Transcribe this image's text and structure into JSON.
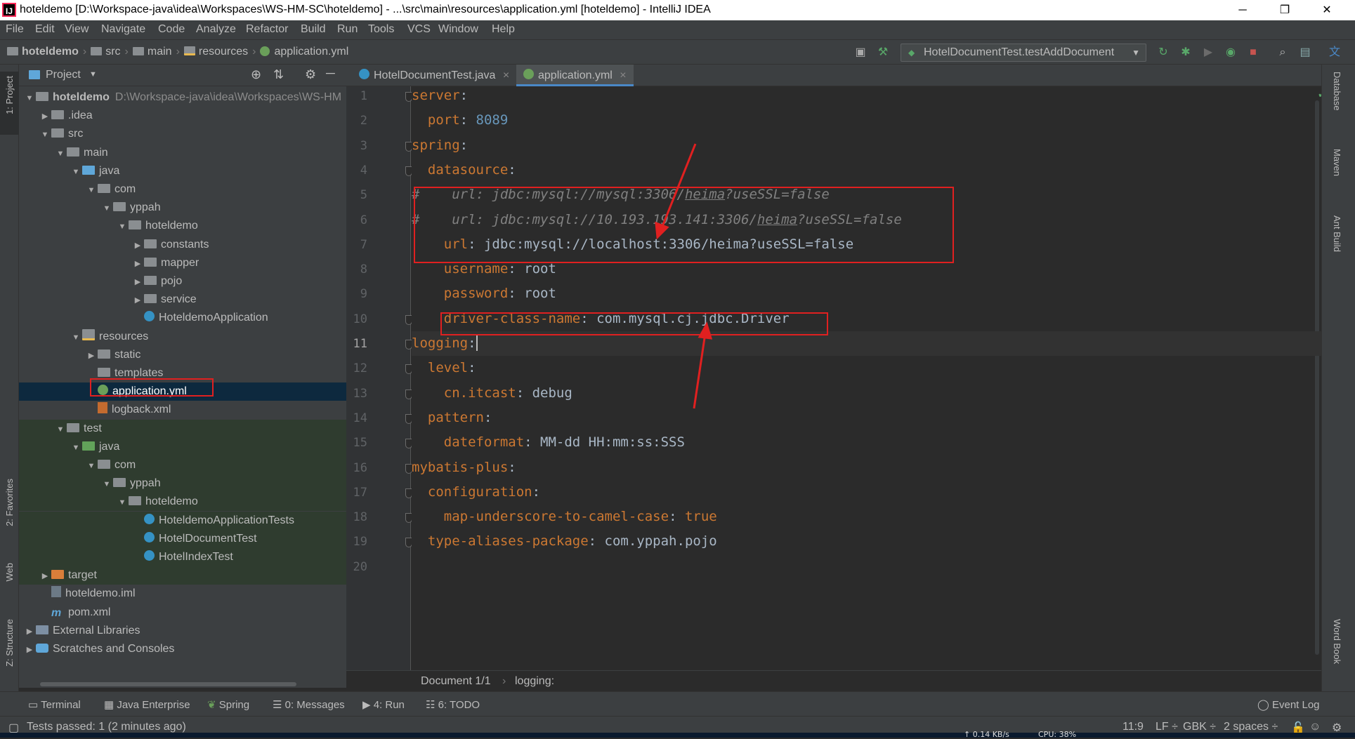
{
  "window": {
    "title": "hoteldemo [D:\\Workspace-java\\idea\\Workspaces\\WS-HM-SC\\hoteldemo] - ...\\src\\main\\resources\\application.yml [hoteldemo] - IntelliJ IDEA",
    "minimize": "─",
    "restore": "❐",
    "close": "✕"
  },
  "menu": [
    "File",
    "Edit",
    "View",
    "Navigate",
    "Code",
    "Analyze",
    "Refactor",
    "Build",
    "Run",
    "Tools",
    "VCS",
    "Window",
    "Help"
  ],
  "navbar": {
    "crumbs": [
      "hoteldemo",
      "src",
      "main",
      "resources",
      "application.yml"
    ],
    "run_config": "HotelDocumentTest.testAddDocument"
  },
  "left_stripe": {
    "project": "1: Project",
    "favorites": "2: Favorites",
    "web": "Web",
    "structure": "Z: Structure"
  },
  "right_stripe": {
    "database": "Database",
    "maven": "Maven",
    "ant": "Ant Build",
    "wordbook": "Word Book"
  },
  "project_panel": {
    "title": "Project",
    "tree": [
      {
        "label": "hoteldemo",
        "extra": "D:\\Workspace-java\\idea\\Workspaces\\WS-HM",
        "depth": 0,
        "arrow": "▼",
        "icon": "folder",
        "bold": true
      },
      {
        "label": ".idea",
        "depth": 1,
        "arrow": "▶",
        "icon": "folder"
      },
      {
        "label": "src",
        "depth": 1,
        "arrow": "▼",
        "icon": "folder"
      },
      {
        "label": "main",
        "depth": 2,
        "arrow": "▼",
        "icon": "folder"
      },
      {
        "label": "java",
        "depth": 3,
        "arrow": "▼",
        "icon": "src"
      },
      {
        "label": "com",
        "depth": 4,
        "arrow": "▼",
        "icon": "folder"
      },
      {
        "label": "yppah",
        "depth": 5,
        "arrow": "▼",
        "icon": "folder"
      },
      {
        "label": "hoteldemo",
        "depth": 6,
        "arrow": "▼",
        "icon": "folder"
      },
      {
        "label": "constants",
        "depth": 7,
        "arrow": "▶",
        "icon": "folder"
      },
      {
        "label": "mapper",
        "depth": 7,
        "arrow": "▶",
        "icon": "folder"
      },
      {
        "label": "pojo",
        "depth": 7,
        "arrow": "▶",
        "icon": "folder"
      },
      {
        "label": "service",
        "depth": 7,
        "arrow": "▶",
        "icon": "folder"
      },
      {
        "label": "HoteldemoApplication",
        "depth": 7,
        "arrow": "",
        "icon": "cls"
      },
      {
        "label": "resources",
        "depth": 3,
        "arrow": "▼",
        "icon": "res"
      },
      {
        "label": "static",
        "depth": 4,
        "arrow": "▶",
        "icon": "folder"
      },
      {
        "label": "templates",
        "depth": 4,
        "arrow": "",
        "icon": "folder"
      },
      {
        "label": "application.yml",
        "depth": 4,
        "arrow": "",
        "icon": "yml",
        "selected": true
      },
      {
        "label": "logback.xml",
        "depth": 4,
        "arrow": "",
        "icon": "xml"
      },
      {
        "label": "test",
        "depth": 2,
        "arrow": "▼",
        "icon": "folder",
        "test": true
      },
      {
        "label": "java",
        "depth": 3,
        "arrow": "▼",
        "icon": "testsrc",
        "test": true
      },
      {
        "label": "com",
        "depth": 4,
        "arrow": "▼",
        "icon": "folder",
        "test": true
      },
      {
        "label": "yppah",
        "depth": 5,
        "arrow": "▼",
        "icon": "folder",
        "test": true
      },
      {
        "label": "hoteldemo",
        "depth": 6,
        "arrow": "▼",
        "icon": "folder",
        "test": true
      },
      {
        "label": "HoteldemoApplicationTests",
        "depth": 7,
        "arrow": "",
        "icon": "cls",
        "test": true
      },
      {
        "label": "HotelDocumentTest",
        "depth": 7,
        "arrow": "",
        "icon": "cls",
        "test": true
      },
      {
        "label": "HotelIndexTest",
        "depth": 7,
        "arrow": "",
        "icon": "cls",
        "test": true
      },
      {
        "label": "target",
        "depth": 1,
        "arrow": "▶",
        "icon": "target",
        "test": true
      },
      {
        "label": "hoteldemo.iml",
        "depth": 1,
        "arrow": "",
        "icon": "iml"
      },
      {
        "label": "pom.xml",
        "depth": 1,
        "arrow": "",
        "icon": "mvn"
      },
      {
        "label": "External Libraries",
        "depth": 0,
        "arrow": "▶",
        "icon": "lib"
      },
      {
        "label": "Scratches and Consoles",
        "depth": 0,
        "arrow": "▶",
        "icon": "scratch"
      }
    ]
  },
  "editor": {
    "tabs": [
      {
        "label": "HotelDocumentTest.java",
        "active": false
      },
      {
        "label": "application.yml",
        "active": true
      }
    ],
    "current_line": 11,
    "lines": [
      [
        [
          "k",
          "server"
        ],
        [
          "p",
          ":"
        ]
      ],
      [
        [
          "p",
          "  "
        ],
        [
          "k",
          "port"
        ],
        [
          "p",
          ": "
        ],
        [
          "n",
          "8089"
        ]
      ],
      [
        [
          "k",
          "spring"
        ],
        [
          "p",
          ":"
        ]
      ],
      [
        [
          "p",
          "  "
        ],
        [
          "k",
          "datasource"
        ],
        [
          "p",
          ":"
        ]
      ],
      [
        [
          "c",
          "#    url: jdbc:mysql://mysql:3306/"
        ],
        [
          "cu",
          "heima"
        ],
        [
          "c",
          "?useSSL=false"
        ]
      ],
      [
        [
          "c",
          "#    url: jdbc:mysql://10.193.193.141:3306/"
        ],
        [
          "cu",
          "heima"
        ],
        [
          "c",
          "?useSSL=false"
        ]
      ],
      [
        [
          "p",
          "    "
        ],
        [
          "k",
          "url"
        ],
        [
          "p",
          ": jdbc:mysql://localhost:3306/heima?useSSL=false"
        ]
      ],
      [
        [
          "p",
          "    "
        ],
        [
          "k",
          "username"
        ],
        [
          "p",
          ": root"
        ]
      ],
      [
        [
          "p",
          "    "
        ],
        [
          "k",
          "password"
        ],
        [
          "p",
          ": root"
        ]
      ],
      [
        [
          "p",
          "    "
        ],
        [
          "k",
          "driver-class-name"
        ],
        [
          "p",
          ": com.mysql.cj.jdbc.Driver"
        ]
      ],
      [
        [
          "k",
          "logging"
        ],
        [
          "p",
          ":"
        ]
      ],
      [
        [
          "p",
          "  "
        ],
        [
          "k",
          "level"
        ],
        [
          "p",
          ":"
        ]
      ],
      [
        [
          "p",
          "    "
        ],
        [
          "k",
          "cn.itcast"
        ],
        [
          "p",
          ": debug"
        ]
      ],
      [
        [
          "p",
          "  "
        ],
        [
          "k",
          "pattern"
        ],
        [
          "p",
          ":"
        ]
      ],
      [
        [
          "p",
          "    "
        ],
        [
          "k",
          "dateformat"
        ],
        [
          "p",
          ": MM-dd HH:mm:ss:SSS"
        ]
      ],
      [
        [
          "k",
          "mybatis-plus"
        ],
        [
          "p",
          ":"
        ]
      ],
      [
        [
          "p",
          "  "
        ],
        [
          "k",
          "configuration"
        ],
        [
          "p",
          ":"
        ]
      ],
      [
        [
          "p",
          "    "
        ],
        [
          "k",
          "map-underscore-to-camel-case"
        ],
        [
          "p",
          ": "
        ],
        [
          "k",
          "true"
        ]
      ],
      [
        [
          "p",
          "  "
        ],
        [
          "k",
          "type-aliases-package"
        ],
        [
          "p",
          ": com.yppah.pojo"
        ]
      ],
      []
    ],
    "breadcrumb": [
      "Document 1/1",
      "logging:"
    ]
  },
  "tool_tabs": [
    "Terminal",
    "Java Enterprise",
    "Spring",
    "0: Messages",
    "4: Run",
    "6: TODO",
    "Event Log"
  ],
  "status": {
    "message": "Tests passed: 1 (2 minutes ago)",
    "position": "11:9",
    "line_sep": "LF ÷",
    "encoding": "GBK ÷",
    "indent": "2 spaces ÷",
    "network": "↑ 0.14 KB/s",
    "cpu": "CPU: 38%"
  },
  "colors": {
    "keyword": "#cc7832",
    "number": "#6897bb",
    "comment": "#808080",
    "annotation_red": "#e02020",
    "selection": "#0d293e"
  }
}
